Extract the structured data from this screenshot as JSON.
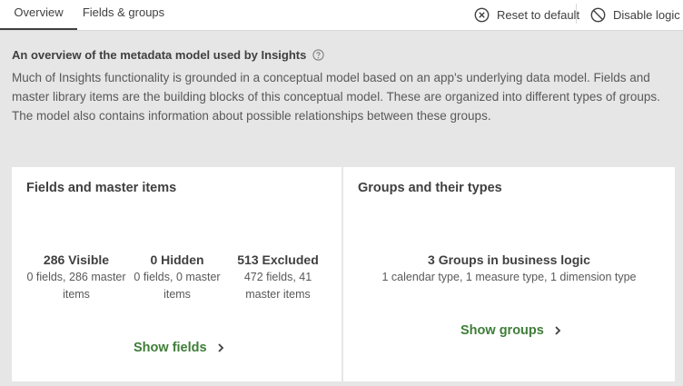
{
  "tabs": [
    {
      "label": "Overview",
      "active": true
    },
    {
      "label": "Fields & groups",
      "active": false
    }
  ],
  "actions": {
    "reset": {
      "label": "Reset to default",
      "icon": "close-circle-icon"
    },
    "disable": {
      "label": "Disable logic",
      "icon": "prohibit-icon"
    }
  },
  "intro": {
    "title": "An overview of the metadata model used by Insights",
    "help_icon": "help-circle-icon",
    "body": "Much of Insights functionality is grounded in a conceptual model based on an app's underlying data model. Fields and master library items are the building blocks of this conceptual model. These are organized into different types of groups. The model also contains information about possible relationships between these groups."
  },
  "fields_card": {
    "title": "Fields and master items",
    "stats": [
      {
        "value": "286 Visible",
        "desc": "0 fields, 286 master items"
      },
      {
        "value": "0 Hidden",
        "desc": "0 fields, 0 master items"
      },
      {
        "value": "513 Excluded",
        "desc": "472 fields, 41 master items"
      }
    ],
    "link_label": "Show fields"
  },
  "groups_card": {
    "title": "Groups and their types",
    "summary": "3 Groups in business logic",
    "detail": "1 calendar type, 1 measure type, 1 dimension type",
    "link_label": "Show groups"
  },
  "colors": {
    "accent_green": "#3f7d39",
    "background": "#e6e6e6",
    "text": "#404040"
  }
}
